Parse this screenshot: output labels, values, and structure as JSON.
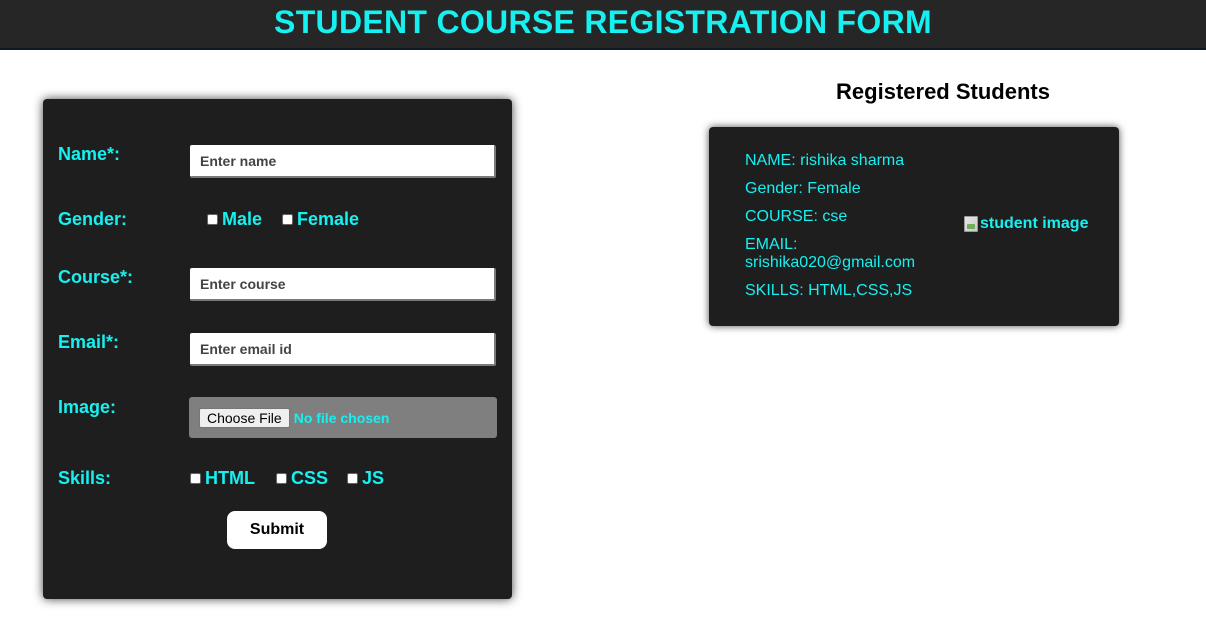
{
  "header": {
    "title": "STUDENT COURSE REGISTRATION FORM"
  },
  "form": {
    "name_label": "Name*:",
    "name_placeholder": "Enter name",
    "gender_label": "Gender:",
    "gender_options": [
      "Male",
      "Female"
    ],
    "course_label": "Course*:",
    "course_placeholder": "Enter course",
    "email_label": "Email*:",
    "email_placeholder": "Enter email id",
    "image_label": "Image:",
    "file_button": "Choose File",
    "file_status": "No file chosen",
    "skills_label": "Skills:",
    "skill_options": [
      "HTML",
      "CSS",
      "JS"
    ],
    "submit_label": "Submit"
  },
  "registered": {
    "title": "Registered Students",
    "students": [
      {
        "name_line": "NAME: rishika sharma",
        "gender_line": "Gender: Female",
        "course_line": "COURSE: cse",
        "email_line": "EMAIL: srishika020@gmail.com",
        "skills_line": "SKILLS: HTML,CSS,JS",
        "image_alt": "student image"
      }
    ]
  },
  "colors": {
    "accent": "#17f0f0",
    "header_bg": "#262626",
    "card_bg": "#1e1e1e"
  }
}
